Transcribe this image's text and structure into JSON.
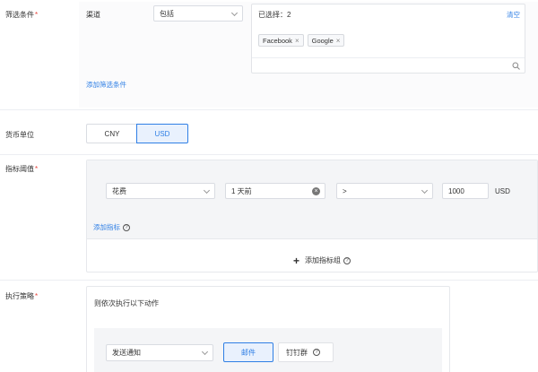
{
  "filter": {
    "label": "筛选条件",
    "field_label": "渠道",
    "operator": "包括",
    "selected_text": "已选择：2",
    "clear_label": "清空",
    "tags": [
      "Facebook",
      "Google"
    ],
    "add_condition": "添加筛选条件"
  },
  "currency": {
    "label": "货币单位",
    "options": [
      "CNY",
      "USD"
    ],
    "selected": "USD"
  },
  "threshold": {
    "label": "指标阈值",
    "metric": "花费",
    "time": "1 天前",
    "comparator": ">",
    "value": "1000",
    "unit": "USD",
    "add_metric": "添加指标",
    "add_group": "添加指标组"
  },
  "strategy": {
    "label": "执行策略",
    "description": "则依次执行以下动作",
    "action": "发送通知",
    "channels": [
      "邮件",
      "钉钉群"
    ],
    "selected_channel": "邮件"
  },
  "colors": {
    "accent": "#2f7fe5",
    "required": "#e8453c",
    "panel": "#f4f5f7"
  }
}
